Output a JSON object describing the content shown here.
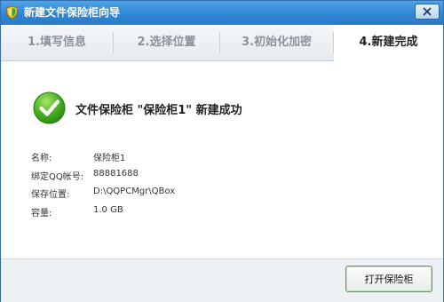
{
  "window": {
    "title": "新建文件保险柜向导"
  },
  "steps": [
    {
      "label": "1.填写信息"
    },
    {
      "label": "2.选择位置"
    },
    {
      "label": "3.初始化加密"
    },
    {
      "label": "4.新建完成"
    }
  ],
  "active_step": 4,
  "result": {
    "message": "文件保险柜 \"保险柜1\" 新建成功",
    "icon": "check-icon"
  },
  "info": [
    {
      "label": "名称:",
      "value": "保险柜1"
    },
    {
      "label": "绑定QQ帐号:",
      "value": "88881688"
    },
    {
      "label": "保存位置:",
      "value": "D:\\QQPCMgr\\QBox"
    },
    {
      "label": "容量:",
      "value": "1.0 GB"
    }
  ],
  "footer": {
    "open_button": "打开保险柜"
  },
  "colors": {
    "titlebar": "#2f86d4",
    "success_green": "#39a51e",
    "active_step_text": "#222222",
    "inactive_step_text": "#8b9299"
  }
}
